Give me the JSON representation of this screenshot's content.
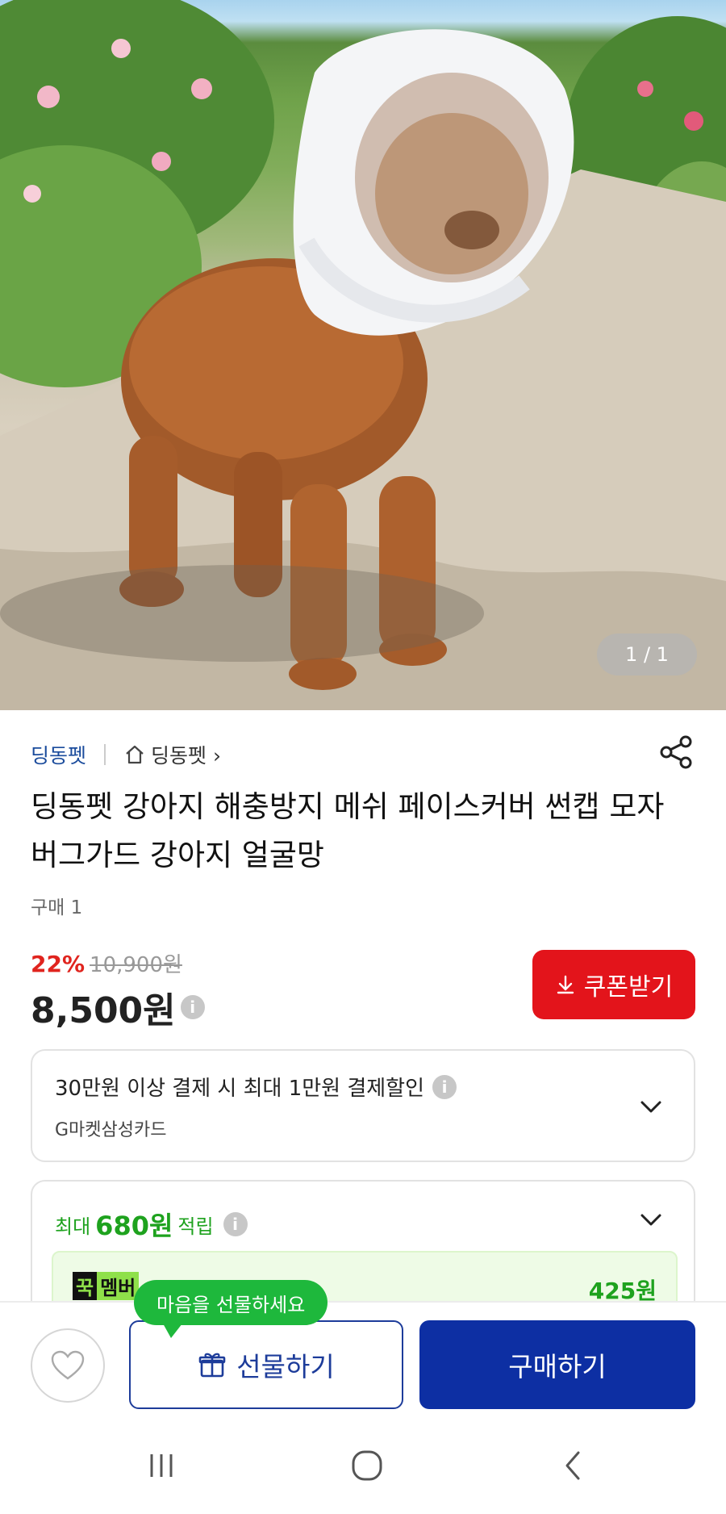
{
  "hero": {
    "image_index": "1 / 1"
  },
  "seller": {
    "name": "딩동펫",
    "home_label": "딩동펫 ›"
  },
  "product": {
    "title": "딩동펫 강아지 해충방지 메쉬 페이스커버 썬캡 모자 버그가드 강아지 얼굴망",
    "purchase_count": "구매 1"
  },
  "price": {
    "discount": "22%",
    "original": "10,900원",
    "current": "8,500원"
  },
  "coupon": {
    "label": "쿠폰받기"
  },
  "card_discount": {
    "main": "30만원 이상 결제 시 최대 1만원 결제할인",
    "sub": "G마켓삼성카드"
  },
  "points": {
    "prefix": "최대",
    "amount": "680원",
    "suffix": "적립",
    "member_badge_1": "꾹",
    "member_badge_2": "멤버",
    "member_amount": "425원"
  },
  "actions": {
    "tooltip": "마음을 선물하세요",
    "gift_label": "선물하기",
    "buy_label": "구매하기"
  },
  "colors": {
    "accent_blue": "#0d2fa3",
    "coupon_red": "#e3141b",
    "point_green": "#1ea21e"
  }
}
